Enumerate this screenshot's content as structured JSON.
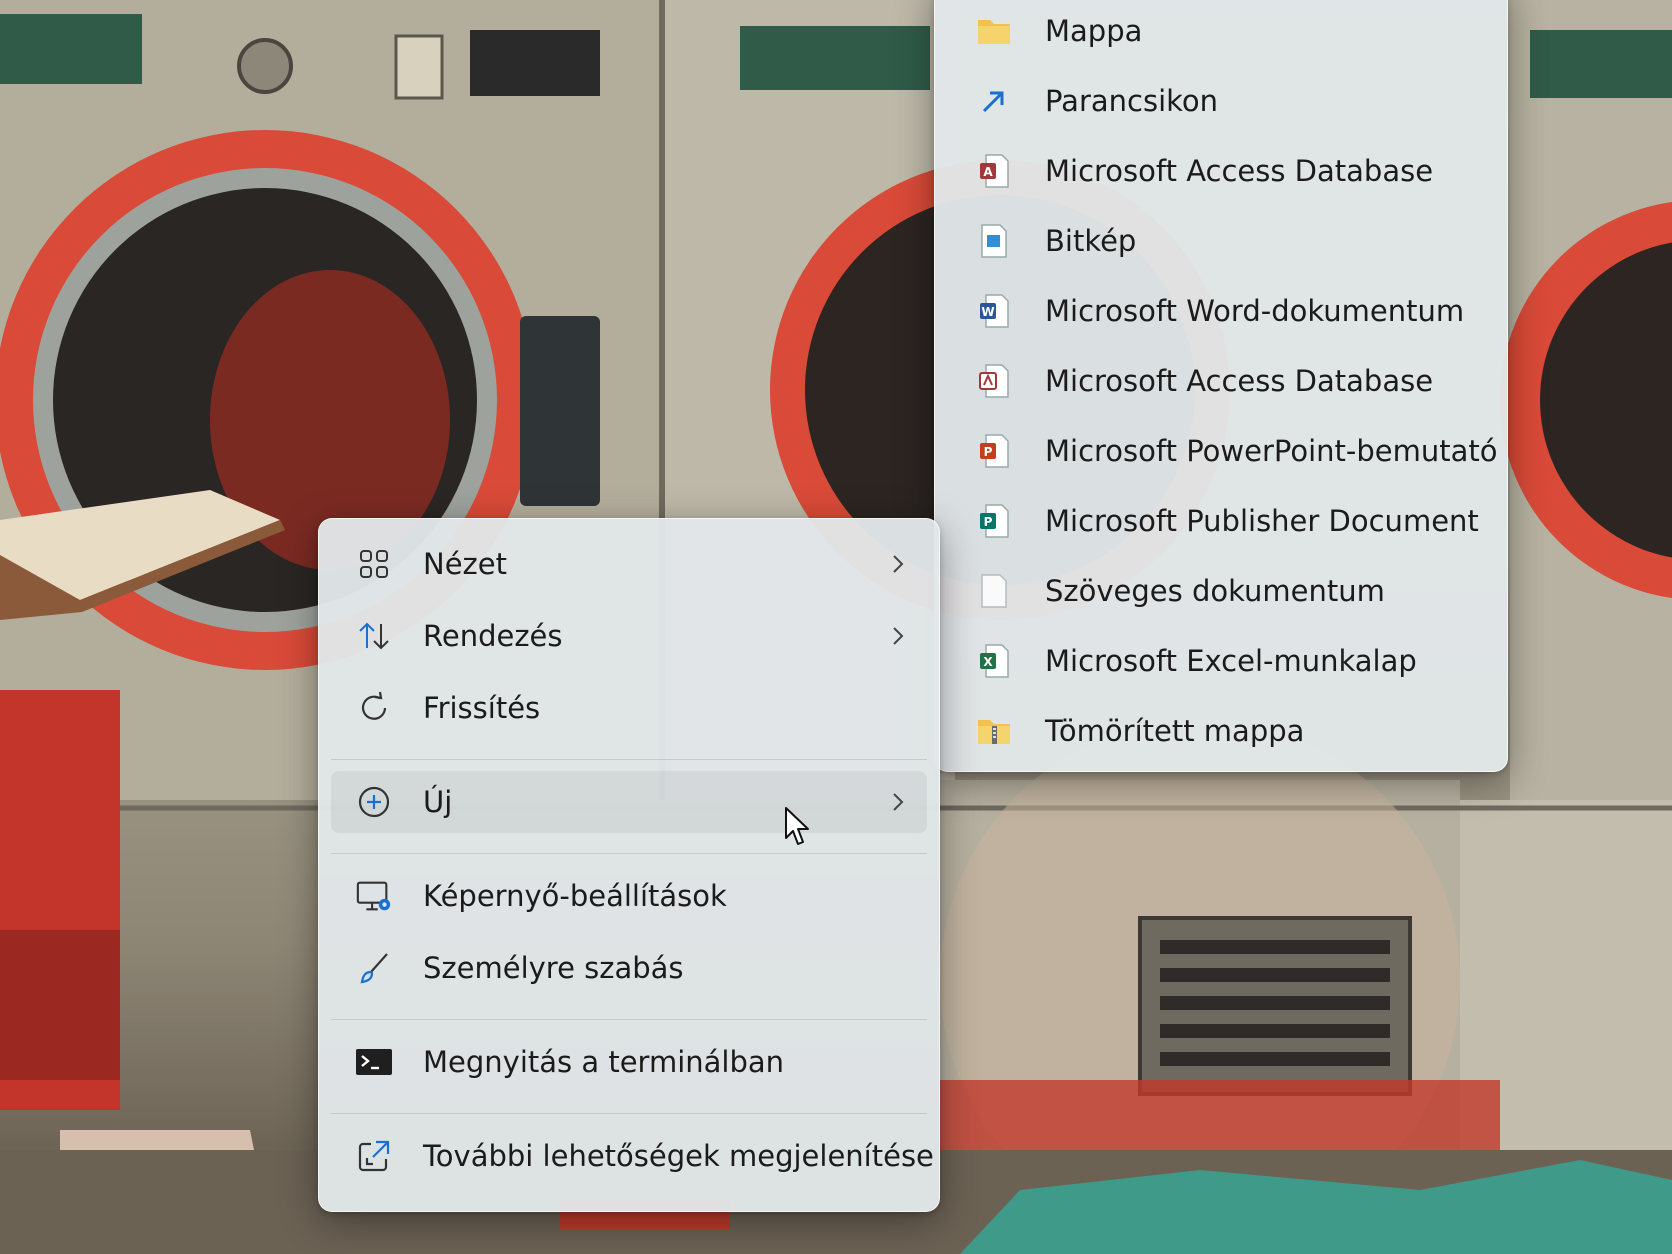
{
  "context_menu": {
    "items": [
      {
        "label": "Nézet",
        "icon": "grid-view-icon"
      },
      {
        "label": "Rendezés",
        "icon": "sort-arrows-icon"
      },
      {
        "label": "Frissítés",
        "icon": "refresh-icon"
      },
      {
        "label": "Új",
        "icon": "add-circle-icon"
      },
      {
        "label": "Képernyő-beállítások",
        "icon": "display-settings-icon"
      },
      {
        "label": "Személyre szabás",
        "icon": "brush-icon"
      },
      {
        "label": "Megnyitás a terminálban",
        "icon": "terminal-icon"
      },
      {
        "label": "További lehetőségek megjelenítése",
        "icon": "show-more-options-icon"
      }
    ]
  },
  "new_submenu": {
    "items": [
      {
        "label": "Mappa",
        "icon": "folder-icon"
      },
      {
        "label": "Parancsikon",
        "icon": "shortcut-arrow-icon"
      },
      {
        "label": "Microsoft Access Database",
        "icon": "access-file-icon"
      },
      {
        "label": "Bitkép",
        "icon": "bitmap-file-icon"
      },
      {
        "label": "Microsoft Word-dokumentum",
        "icon": "word-file-icon"
      },
      {
        "label": "Microsoft Access Database",
        "icon": "access-file-icon"
      },
      {
        "label": "Microsoft PowerPoint-bemutató",
        "icon": "powerpoint-file-icon"
      },
      {
        "label": "Microsoft Publisher Document",
        "icon": "publisher-file-icon"
      },
      {
        "label": "Szöveges dokumentum",
        "icon": "text-file-icon"
      },
      {
        "label": "Microsoft Excel-munkalap",
        "icon": "excel-file-icon"
      },
      {
        "label": "Tömörített mappa",
        "icon": "zip-folder-icon"
      }
    ]
  },
  "colors": {
    "menu_background": "#e2e7e9",
    "accent_blue": "#1a6fd0",
    "access_red": "#a4373a",
    "word_blue": "#2b579a",
    "powerpoint_red": "#c43e1c",
    "publisher_teal": "#077568",
    "excel_green": "#217346",
    "folder_yellow": "#f2c14e"
  }
}
